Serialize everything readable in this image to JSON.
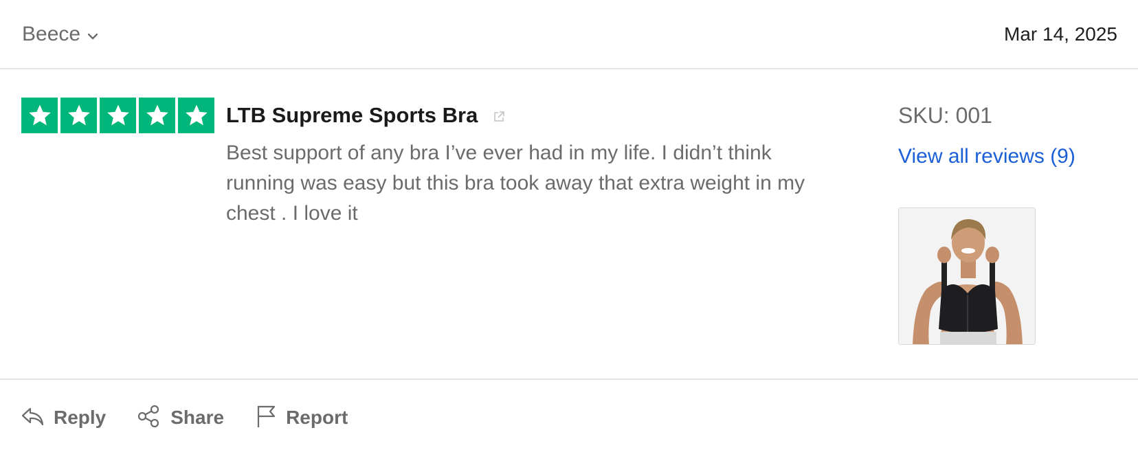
{
  "header": {
    "reviewer_name": "Beece",
    "date": "Mar 14, 2025"
  },
  "review": {
    "rating": 5,
    "max_rating": 5,
    "star_color": "#00b67a",
    "product_title": "LTB Supreme Sports Bra",
    "body": "Best support of any bra I’ve ever had in my life. I didn’t think running was easy but this bra took away that extra weight in my chest . I love it"
  },
  "product": {
    "sku": "SKU: 001",
    "view_all_label": "View all reviews (9)",
    "link_color": "#1a5fd6"
  },
  "actions": {
    "reply_label": "Reply",
    "share_label": "Share",
    "report_label": "Report"
  },
  "icons": [
    "chevron-down-icon",
    "star-icon",
    "external-link-icon",
    "reply-icon",
    "share-icon",
    "flag-icon"
  ]
}
